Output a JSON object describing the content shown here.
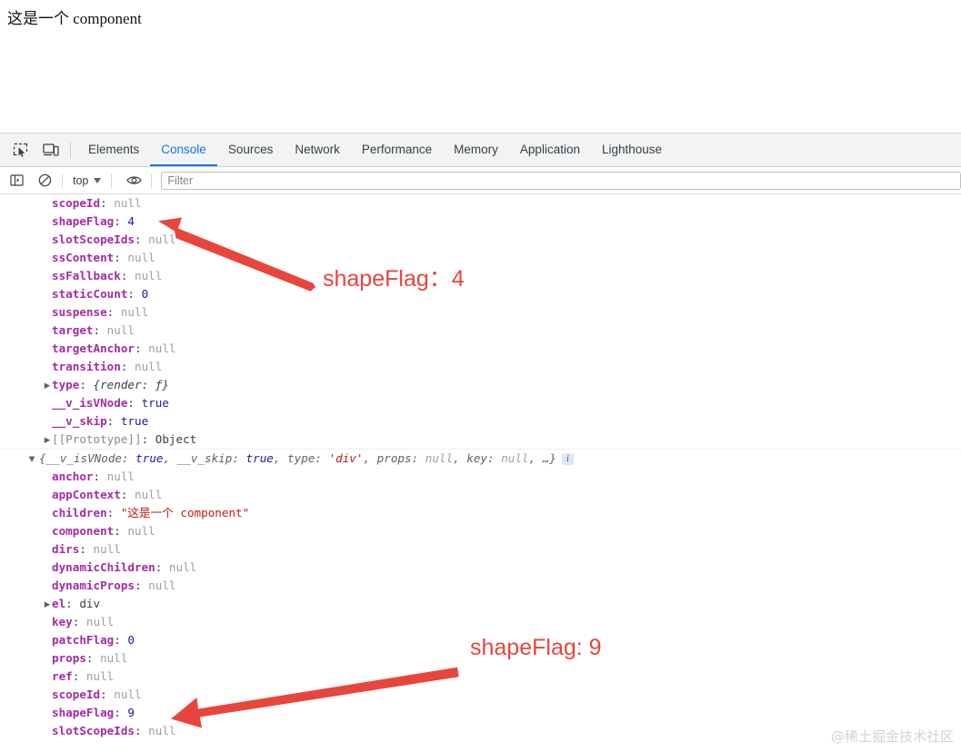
{
  "page": {
    "content_text": "这是一个 component"
  },
  "devtools": {
    "toolbar_icons": [
      {
        "name": "inspect-element-icon",
        "glyph": "inspect"
      },
      {
        "name": "device-toolbar-icon",
        "glyph": "device"
      }
    ],
    "tabs": [
      {
        "label": "Elements",
        "active": false
      },
      {
        "label": "Console",
        "active": true
      },
      {
        "label": "Sources",
        "active": false
      },
      {
        "label": "Network",
        "active": false
      },
      {
        "label": "Performance",
        "active": false
      },
      {
        "label": "Memory",
        "active": false
      },
      {
        "label": "Application",
        "active": false
      },
      {
        "label": "Lighthouse",
        "active": false
      }
    ],
    "filterbar": {
      "sidebar_toggle_icon": "sidebar-icon",
      "clear_console_icon": "clear-console-icon",
      "context_value": "top",
      "eye_icon": "eye-icon",
      "filter_placeholder": "Filter",
      "filter_value": ""
    },
    "accent_color": "#1a73e8",
    "tabbar_bg": "#f1f3f4"
  },
  "console": {
    "messages": [
      {
        "id": "vnode-component",
        "has_header": false,
        "rows": [
          {
            "key": "scopeId",
            "sep": ": ",
            "value": "null",
            "vtype": "null",
            "expandable": false
          },
          {
            "key": "shapeFlag",
            "sep": ": ",
            "value": "4",
            "vtype": "num",
            "expandable": false
          },
          {
            "key": "slotScopeIds",
            "sep": ": ",
            "value": "null",
            "vtype": "null",
            "expandable": false
          },
          {
            "key": "ssContent",
            "sep": ": ",
            "value": "null",
            "vtype": "null",
            "expandable": false
          },
          {
            "key": "ssFallback",
            "sep": ": ",
            "value": "null",
            "vtype": "null",
            "expandable": false
          },
          {
            "key": "staticCount",
            "sep": ": ",
            "value": "0",
            "vtype": "num",
            "expandable": false
          },
          {
            "key": "suspense",
            "sep": ": ",
            "value": "null",
            "vtype": "null",
            "expandable": false
          },
          {
            "key": "target",
            "sep": ": ",
            "value": "null",
            "vtype": "null",
            "expandable": false
          },
          {
            "key": "targetAnchor",
            "sep": ": ",
            "value": "null",
            "vtype": "null",
            "expandable": false
          },
          {
            "key": "transition",
            "sep": ": ",
            "value": "null",
            "vtype": "null",
            "expandable": false
          },
          {
            "key": "type",
            "sep": ": ",
            "value": "{render: ƒ}",
            "vtype": "fn",
            "expandable": true
          },
          {
            "key": "__v_isVNode",
            "sep": ": ",
            "value": "true",
            "vtype": "bool",
            "expandable": false
          },
          {
            "key": "__v_skip",
            "sep": ": ",
            "value": "true",
            "vtype": "bool",
            "expandable": false
          },
          {
            "key": "[[Prototype]]",
            "sep": ": ",
            "value": "Object",
            "vtype": "obj",
            "expandable": true,
            "proto": true
          }
        ]
      },
      {
        "id": "vnode-div",
        "has_header": true,
        "header": {
          "expanded": true,
          "parts": [
            {
              "t": "{",
              "c": "s-key"
            },
            {
              "t": "__v_isVNode",
              "c": "s-key"
            },
            {
              "t": ": ",
              "c": "s-key"
            },
            {
              "t": "true",
              "c": "s-bool"
            },
            {
              "t": ", ",
              "c": "s-key"
            },
            {
              "t": "__v_skip",
              "c": "s-key"
            },
            {
              "t": ": ",
              "c": "s-key"
            },
            {
              "t": "true",
              "c": "s-bool"
            },
            {
              "t": ", ",
              "c": "s-key"
            },
            {
              "t": "type",
              "c": "s-key"
            },
            {
              "t": ": ",
              "c": "s-key"
            },
            {
              "t": "'div'",
              "c": "s-str"
            },
            {
              "t": ", ",
              "c": "s-key"
            },
            {
              "t": "props",
              "c": "s-key"
            },
            {
              "t": ": ",
              "c": "s-key"
            },
            {
              "t": "null",
              "c": "s-null"
            },
            {
              "t": ", ",
              "c": "s-key"
            },
            {
              "t": "key",
              "c": "s-key"
            },
            {
              "t": ": ",
              "c": "s-key"
            },
            {
              "t": "null",
              "c": "s-null"
            },
            {
              "t": ", …}",
              "c": "s-key"
            }
          ],
          "info_badge": "i"
        },
        "rows": [
          {
            "key": "anchor",
            "sep": ": ",
            "value": "null",
            "vtype": "null",
            "expandable": false
          },
          {
            "key": "appContext",
            "sep": ": ",
            "value": "null",
            "vtype": "null",
            "expandable": false
          },
          {
            "key": "children",
            "sep": ": ",
            "value": "\"这是一个 component\"",
            "vtype": "str",
            "expandable": false
          },
          {
            "key": "component",
            "sep": ": ",
            "value": "null",
            "vtype": "null",
            "expandable": false
          },
          {
            "key": "dirs",
            "sep": ": ",
            "value": "null",
            "vtype": "null",
            "expandable": false
          },
          {
            "key": "dynamicChildren",
            "sep": ": ",
            "value": "null",
            "vtype": "null",
            "expandable": false
          },
          {
            "key": "dynamicProps",
            "sep": ": ",
            "value": "null",
            "vtype": "null",
            "expandable": false
          },
          {
            "key": "el",
            "sep": ": ",
            "value": "div",
            "vtype": "dom",
            "expandable": true
          },
          {
            "key": "key",
            "sep": ": ",
            "value": "null",
            "vtype": "null",
            "expandable": false
          },
          {
            "key": "patchFlag",
            "sep": ": ",
            "value": "0",
            "vtype": "num",
            "expandable": false
          },
          {
            "key": "props",
            "sep": ": ",
            "value": "null",
            "vtype": "null",
            "expandable": false
          },
          {
            "key": "ref",
            "sep": ": ",
            "value": "null",
            "vtype": "null",
            "expandable": false
          },
          {
            "key": "scopeId",
            "sep": ": ",
            "value": "null",
            "vtype": "null",
            "expandable": false
          },
          {
            "key": "shapeFlag",
            "sep": ": ",
            "value": "9",
            "vtype": "num",
            "expandable": false
          },
          {
            "key": "slotScopeIds",
            "sep": ": ",
            "value": "null",
            "vtype": "null",
            "expandable": false
          }
        ]
      }
    ]
  },
  "annotations": {
    "color": "#e8453c",
    "items": [
      {
        "name": "annotation-shapeflag-4",
        "text": "shapeFlag：4"
      },
      {
        "name": "annotation-shapeflag-9",
        "text": "shapeFlag: 9"
      }
    ]
  },
  "watermark": {
    "text": "@稀土掘金技术社区"
  }
}
